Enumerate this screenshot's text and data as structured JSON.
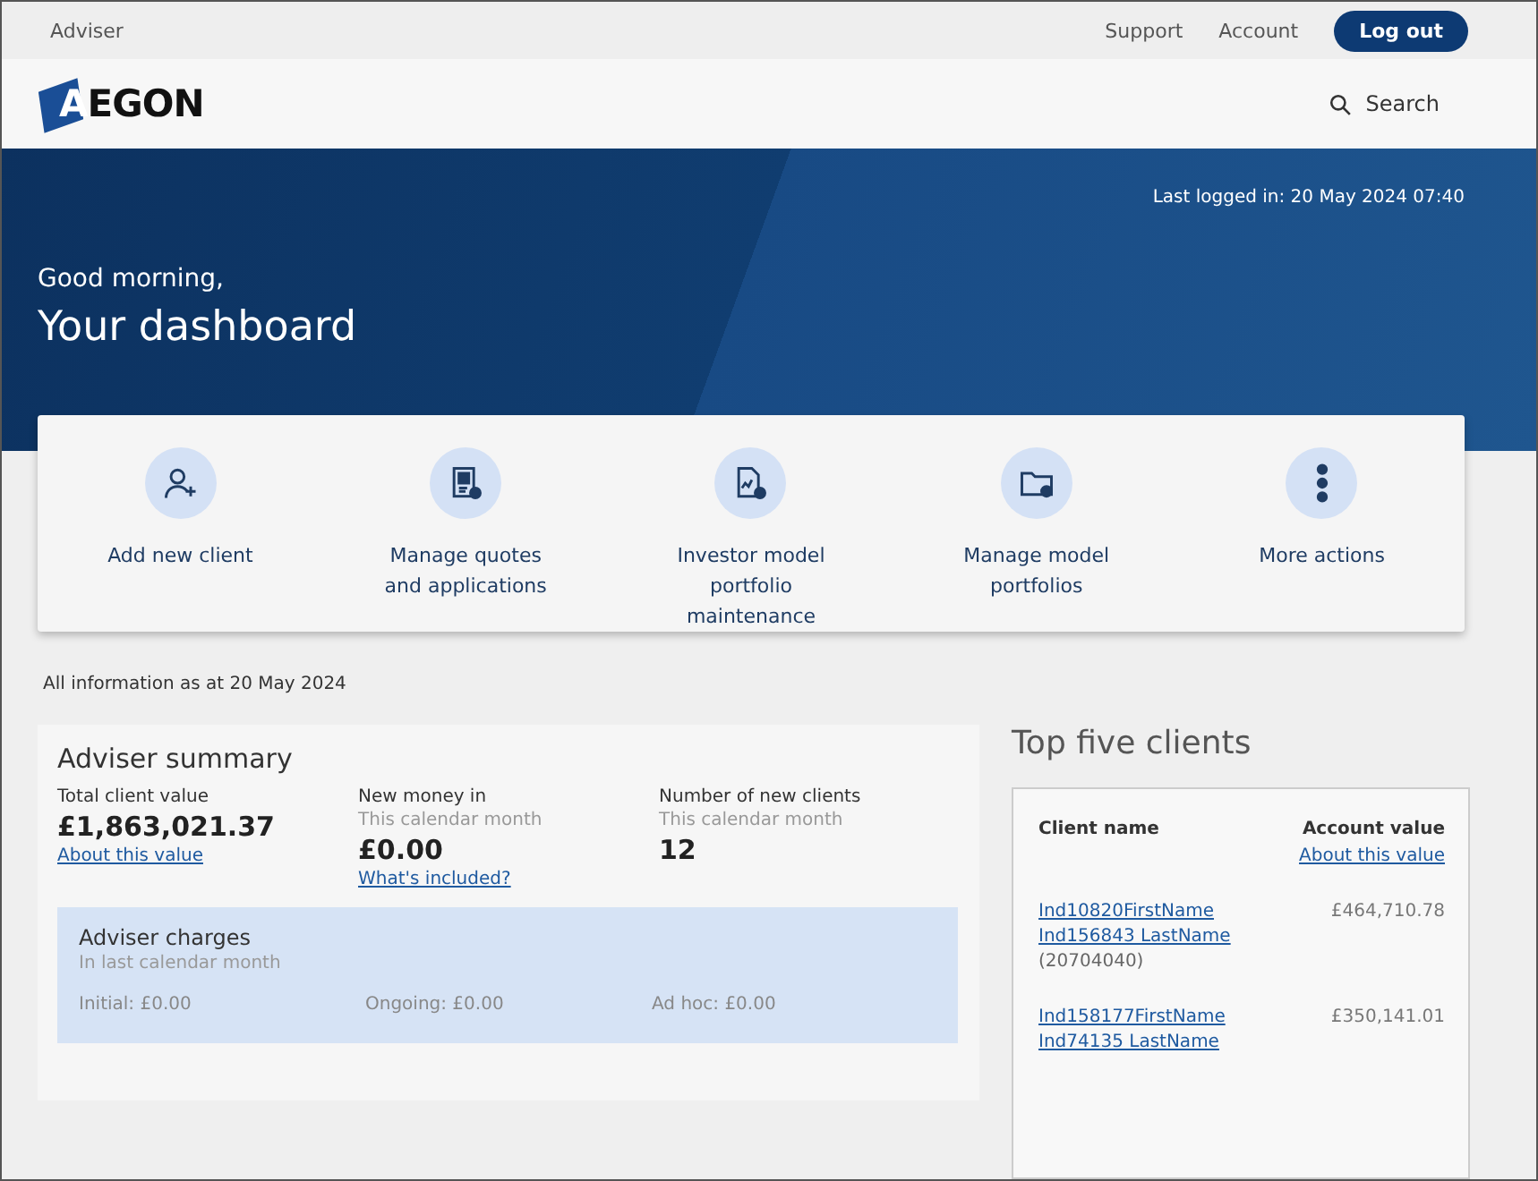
{
  "top_bar": {
    "role": "Adviser",
    "links": [
      "Support",
      "Account"
    ],
    "logout": "Log out"
  },
  "header": {
    "logo": "AEGON",
    "search": "Search"
  },
  "hero": {
    "last_logged": "Last logged in: 20 May 2024 07:40",
    "greeting": "Good morning,",
    "title": "Your dashboard"
  },
  "actions": [
    {
      "kind": "add-user",
      "label": "Add new client"
    },
    {
      "kind": "document",
      "label": "Manage quotes and applications"
    },
    {
      "kind": "chart-doc",
      "label": "Investor model portfolio maintenance"
    },
    {
      "kind": "folder",
      "label": "Manage model portfolios"
    },
    {
      "kind": "more",
      "label": "More actions"
    }
  ],
  "info_date": "All information as at 20 May 2024",
  "summary": {
    "title": "Adviser summary",
    "stats": [
      {
        "label": "Total client value",
        "value": "£1,863,021.37",
        "link": "About this value"
      },
      {
        "label": "New money in",
        "sub": "This calendar month",
        "value": "£0.00",
        "link": "What's included?"
      },
      {
        "label": "Number of new clients",
        "sub": "This calendar month",
        "value": "12"
      }
    ],
    "charges": {
      "title": "Adviser charges",
      "sub": "In last calendar month",
      "items": [
        "Initial: £0.00",
        "Ongoing: £0.00",
        "Ad hoc: £0.00"
      ]
    }
  },
  "top_clients": {
    "title": "Top five clients",
    "columns": [
      "Client name",
      "Account value"
    ],
    "value_link": "About this value",
    "rows": [
      {
        "names": [
          "Ind10820FirstName",
          "Ind156843 LastName"
        ],
        "id": "(20704040)",
        "value": "£464,710.78"
      },
      {
        "names": [
          "Ind158177FirstName",
          "Ind74135 LastName"
        ],
        "value": "£350,141.01"
      }
    ]
  }
}
